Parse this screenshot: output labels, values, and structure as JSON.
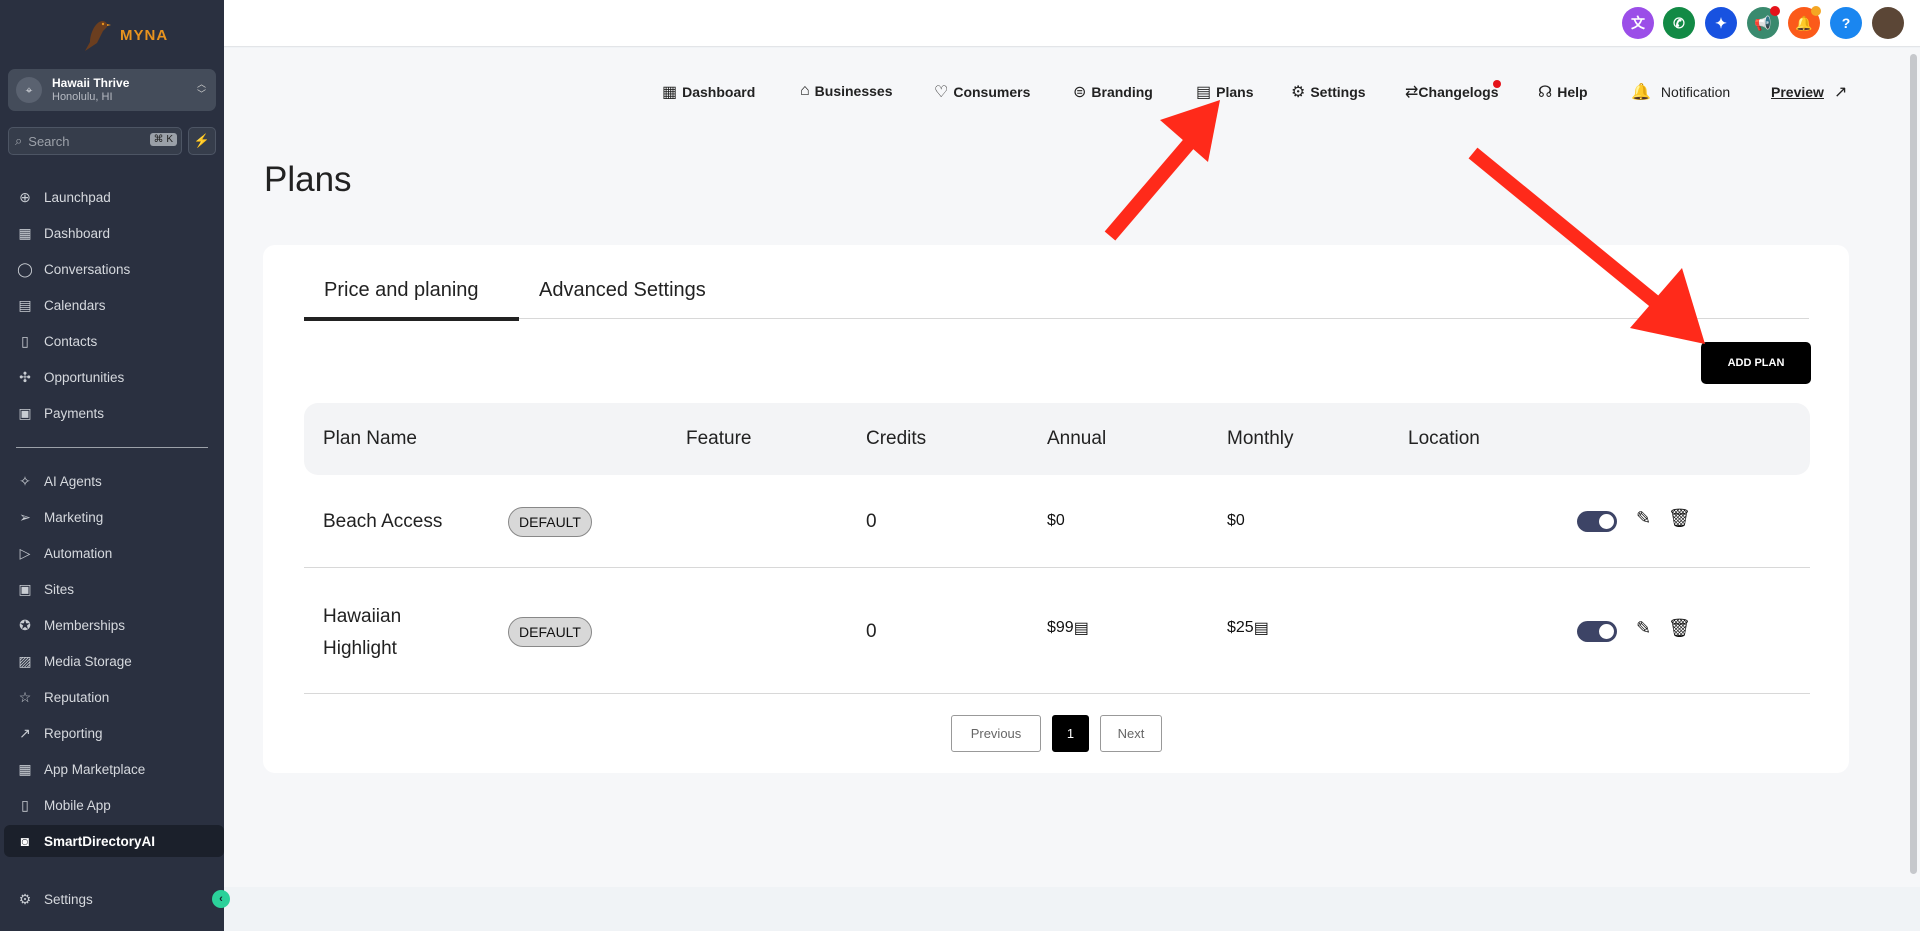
{
  "sidebar": {
    "logo_text": "MYNA",
    "account": {
      "name": "Hawaii Thrive",
      "location": "Honolulu, HI"
    },
    "search": {
      "placeholder": "Search",
      "shortcut": "⌘ K"
    },
    "items": [
      {
        "label": "Launchpad",
        "icon": "launchpad-icon"
      },
      {
        "label": "Dashboard",
        "icon": "grid-icon"
      },
      {
        "label": "Conversations",
        "icon": "chat-icon"
      },
      {
        "label": "Calendars",
        "icon": "calendar-icon"
      },
      {
        "label": "Contacts",
        "icon": "contacts-icon"
      },
      {
        "label": "Opportunities",
        "icon": "opportunities-icon"
      },
      {
        "label": "Payments",
        "icon": "payments-icon"
      }
    ],
    "items2": [
      {
        "label": "AI Agents"
      },
      {
        "label": "Marketing"
      },
      {
        "label": "Automation"
      },
      {
        "label": "Sites"
      },
      {
        "label": "Memberships"
      },
      {
        "label": "Media Storage"
      },
      {
        "label": "Reputation"
      },
      {
        "label": "Reporting"
      },
      {
        "label": "App Marketplace"
      },
      {
        "label": "Mobile App"
      },
      {
        "label": "SmartDirectoryAI"
      }
    ],
    "settings": "Settings"
  },
  "topnav": {
    "dashboard": "Dashboard",
    "businesses": "Businesses",
    "consumers": "Consumers",
    "branding": "Branding",
    "plans": "Plans",
    "settings": "Settings",
    "changelogs": "Changelogs",
    "help": "Help",
    "notification": "Notification",
    "preview": "Preview"
  },
  "page": {
    "title": "Plans",
    "tabs": [
      "Price and planing",
      "Advanced Settings"
    ],
    "add_plan": "ADD PLAN",
    "columns": [
      "Plan Name",
      "Feature",
      "Credits",
      "Annual",
      "Monthly",
      "Location"
    ],
    "rows": [
      {
        "name": "Beach Access",
        "badge": "DEFAULT",
        "credits": "0",
        "annual": "$0",
        "monthly": "$0",
        "enabled": true
      },
      {
        "name": "Hawaiian Highlight",
        "badge": "DEFAULT",
        "credits": "0",
        "annual": "$99",
        "monthly": "$25",
        "enabled": true
      }
    ],
    "pagination": {
      "previous": "Previous",
      "current": "1",
      "next": "Next"
    }
  },
  "colors": {
    "sidebar": "#2a3040",
    "accent": "#2bd19a",
    "annotation": "#ff2a1a"
  }
}
